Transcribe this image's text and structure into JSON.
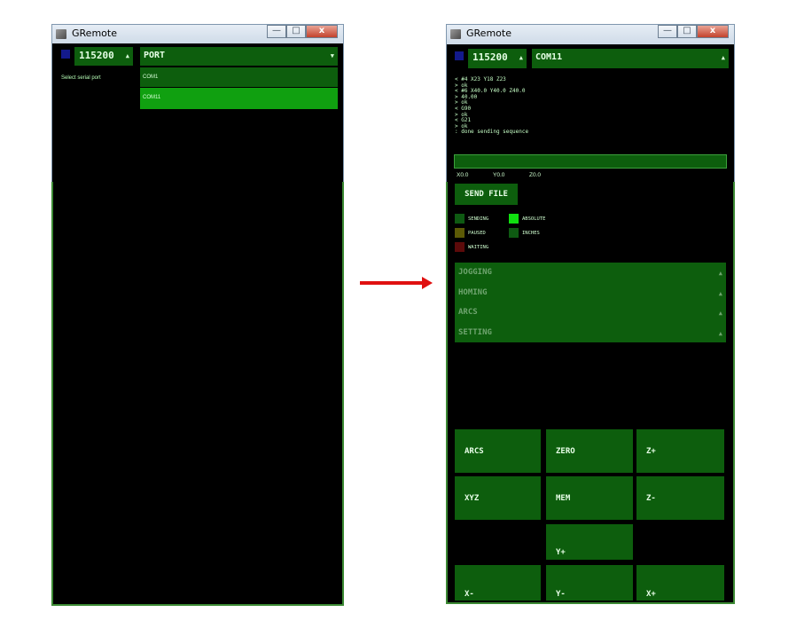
{
  "left_window": {
    "title": "GRemote",
    "window_controls": {
      "minimize": "—",
      "maximize": "□",
      "close": "x"
    },
    "baud": "115200",
    "baud_caret": "▲",
    "port": {
      "label": "PORT",
      "caret": "▼",
      "options": [
        "COM1",
        "COM11"
      ],
      "highlighted": "COM11"
    },
    "status": "Select serial port"
  },
  "right_window": {
    "title": "GRemote",
    "window_controls": {
      "minimize": "—",
      "maximize": "□",
      "close": "x"
    },
    "baud": "115200",
    "baud_caret": "▲",
    "port": {
      "label": "COM11",
      "caret": "▲"
    },
    "console": [
      "< #4 X23 Y18 Z23",
      "> ok",
      "< #6 X40.0 Y40.0 Z40.0",
      "> 40.00",
      "> ok",
      "< G90",
      "> ok",
      "< G21",
      "> ok",
      ": done sending sequence"
    ],
    "coords": {
      "x": "X0.0",
      "y": "Y0.0",
      "z": "Z0.0"
    },
    "send_file": "SEND FILE",
    "legend": [
      {
        "label": "SENDING",
        "color": "#0e5a12"
      },
      {
        "label": "ABSOLUTE",
        "color": "#10e010"
      },
      {
        "label": "PAUSED",
        "color": "#5c5a06"
      },
      {
        "label": "INCHES",
        "color": "#0e5a12"
      },
      {
        "label": "WAITING",
        "color": "#5c0a0a"
      }
    ],
    "accordion": [
      "JOGGING",
      "HOMING",
      "ARCS",
      "SETTING"
    ],
    "accordion_caret": "▲",
    "pad": {
      "arcs": "ARCS",
      "zero": "ZERO",
      "z_plus": "Z+",
      "xyz": "XYZ",
      "mem": "MEM",
      "z_minus": "Z-",
      "y_plus": "Y+",
      "x_minus": "X-",
      "y_minus": "Y-",
      "x_plus": "X+"
    }
  },
  "colors": {
    "panel_green": "#0d5e0d",
    "highlight_green": "#10a010",
    "arrow_red": "#e01010"
  }
}
